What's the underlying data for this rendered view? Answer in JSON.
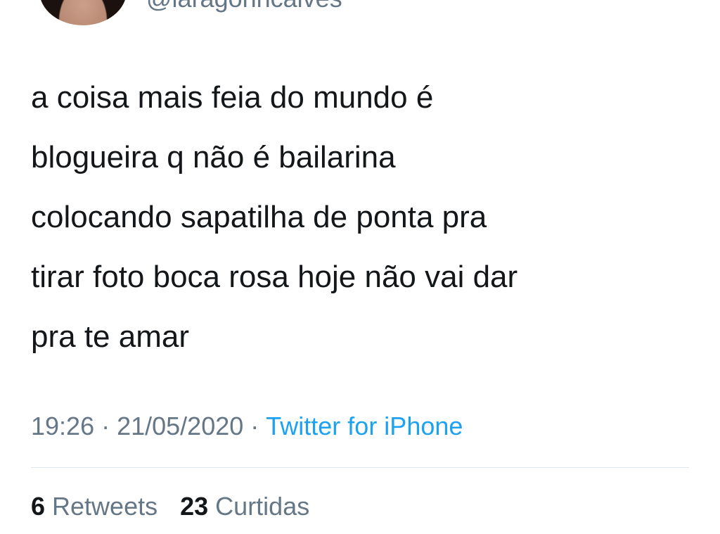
{
  "author": {
    "handle": "@laragonncalves"
  },
  "tweet": {
    "text": "a coisa mais feia do mundo é\nblogueira q não é bailarina\ncolocando sapatilha de ponta pra\ntirar foto boca rosa hoje não vai dar\npra te amar"
  },
  "meta": {
    "time": "19:26",
    "separator": "·",
    "date": "21/05/2020",
    "source": "Twitter for iPhone"
  },
  "stats": {
    "retweets_count": "6",
    "retweets_label": "Retweets",
    "likes_count": "23",
    "likes_label": "Curtidas"
  },
  "colors": {
    "text": "#14171a",
    "secondary": "#657786",
    "link": "#1da1f2",
    "divider": "#e1e8ed"
  }
}
